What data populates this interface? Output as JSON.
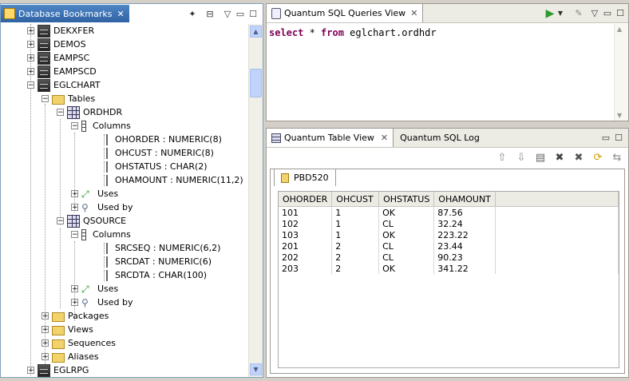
{
  "left_view": {
    "title": "Database Bookmarks",
    "close": "✕"
  },
  "tree": {
    "databases_top": [
      {
        "label": "DEKXFER"
      },
      {
        "label": "DEMOS"
      },
      {
        "label": "EAMPSC"
      },
      {
        "label": "EAMPSCD"
      }
    ],
    "eglchart": {
      "label": "EGLCHART",
      "tables_label": "Tables",
      "ordhdr": {
        "label": "ORDHDR",
        "columns_label": "Columns",
        "columns": [
          "OHORDER : NUMERIC(8)",
          "OHCUST : NUMERIC(8)",
          "OHSTATUS : CHAR(2)",
          "OHAMOUNT : NUMERIC(11,2)"
        ],
        "uses_label": "Uses",
        "used_by_label": "Used by"
      },
      "qsource": {
        "label": "QSOURCE",
        "columns_label": "Columns",
        "columns": [
          "SRCSEQ : NUMERIC(6,2)",
          "SRCDAT : NUMERIC(6)",
          "SRCDTA : CHAR(100)"
        ],
        "uses_label": "Uses",
        "used_by_label": "Used by"
      },
      "packages_label": "Packages",
      "views_label": "Views",
      "sequences_label": "Sequences",
      "aliases_label": "Aliases"
    },
    "egl_rpg": "EGLRPG"
  },
  "sql_view": {
    "title": "Quantum SQL Queries View",
    "kw_select": "select",
    "star": " * ",
    "kw_from": "from",
    "target": " eglchart.ordhdr"
  },
  "table_view": {
    "title": "Quantum Table View",
    "log_tab": "Quantum SQL Log",
    "result_tab": "PBD520",
    "columns": [
      "OHORDER",
      "OHCUST",
      "OHSTATUS",
      "OHAMOUNT"
    ],
    "rows": [
      [
        "101",
        "1",
        "OK",
        "87.56"
      ],
      [
        "102",
        "1",
        "CL",
        "32.24"
      ],
      [
        "103",
        "1",
        "OK",
        "223.22"
      ],
      [
        "201",
        "2",
        "CL",
        "23.44"
      ],
      [
        "202",
        "2",
        "CL",
        "90.23"
      ],
      [
        "203",
        "2",
        "OK",
        "341.22"
      ]
    ]
  },
  "colors": {
    "active_tab": "#2f62a3",
    "keyword": "#7f0055",
    "run": "#2e9b2e"
  }
}
